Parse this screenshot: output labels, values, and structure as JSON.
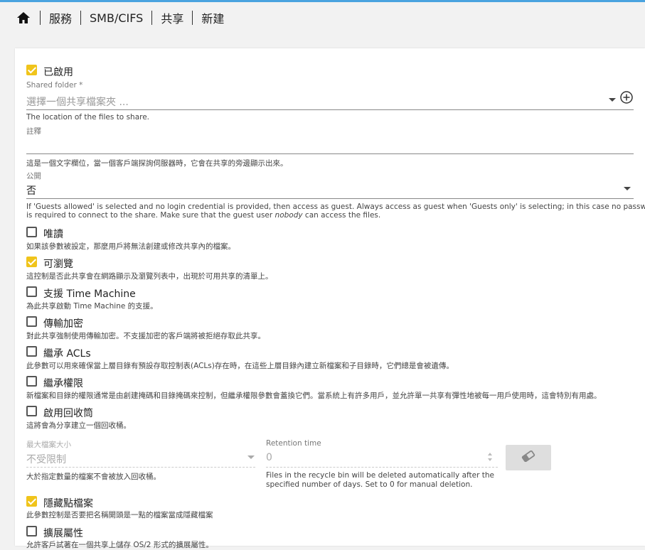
{
  "breadcrumb": {
    "home_icon": "home-icon",
    "items": [
      "服務",
      "SMB/CIFS",
      "共享",
      "新建"
    ]
  },
  "enabled": {
    "label": "已啟用",
    "checked": true
  },
  "shared_folder": {
    "label": "Shared folder *",
    "placeholder": "選擇一個共享檔案夾 ...",
    "hint": "The location of the files to share."
  },
  "comment": {
    "label": "註釋",
    "value": "",
    "hint": "這是一個文字欄位，當一個客戶端探詢伺服器時，它會在共享的旁邊顯示出來。"
  },
  "public": {
    "label": "公開",
    "value": "否",
    "hint_line1": "If 'Guests allowed' is selected and no login credential is provided, then access as guest. Always access as guest when 'Guests only' is selecting; in this case no password",
    "hint_line2_pre": "is required to connect to the share. Make sure that the guest user ",
    "hint_line2_em": "nobody",
    "hint_line2_post": " can access the files."
  },
  "options": [
    {
      "label": "唯讀",
      "checked": false,
      "hint": "如果該參數被設定，那麼用戶將無法創建或修改共享內的檔案。"
    },
    {
      "label": "可瀏覽",
      "checked": true,
      "hint": "這控制是否此共享會在網路顯示及瀏覽列表中，出現於可用共享的清單上。"
    },
    {
      "label": "支援 Time Machine",
      "checked": false,
      "hint": "為此共享啟動 Time Machine 的支援。"
    },
    {
      "label": "傳輸加密",
      "checked": false,
      "hint": "對此共享強制使用傳輸加密。不支援加密的客戶端將被拒絕存取此共享。"
    },
    {
      "label": "繼承 ACLs",
      "checked": false,
      "hint": "此參數可以用來確保當上層目錄有預設存取控制表(ACLs)存在時，在這些上層目錄內建立新檔案和子目錄時，它們總是會被遺傳。"
    },
    {
      "label": "繼承權限",
      "checked": false,
      "hint": "新檔案和目錄的權限通常是由創建掩碼和目錄掩碼來控制，但繼承權限參數會蓋換它們。當系統上有許多用戶，並允許單一共享有彈性地被每一用戶使用時，這會特別有用處。"
    },
    {
      "label": "啟用回收筒",
      "checked": false,
      "hint": "這將會為分享建立一個回收桶。"
    }
  ],
  "max_file_size": {
    "label": "最大檔案大小",
    "value": "不受限制",
    "hint": "大於指定數量的檔案不會被放入回收桶。"
  },
  "retention_time": {
    "label": "Retention time",
    "value": "0",
    "hint_line1": "Files in the recycle bin will be deleted automatically after the",
    "hint_line2": "specified number of days. Set to 0 for manual deletion."
  },
  "hide_dot_files": {
    "label": "隱藏點檔案",
    "checked": true,
    "hint": "此參數控制是否要把名稱開頭是一點的檔案當成隱藏檔案"
  },
  "extended_attributes": {
    "label": "擴展屬性",
    "checked": false,
    "hint": "允許客戶試著在一個共享上儲存 OS/2 形式的擴展屬性。"
  },
  "colors": {
    "accent": "#f0c41b",
    "topline": "#4aa3df"
  }
}
